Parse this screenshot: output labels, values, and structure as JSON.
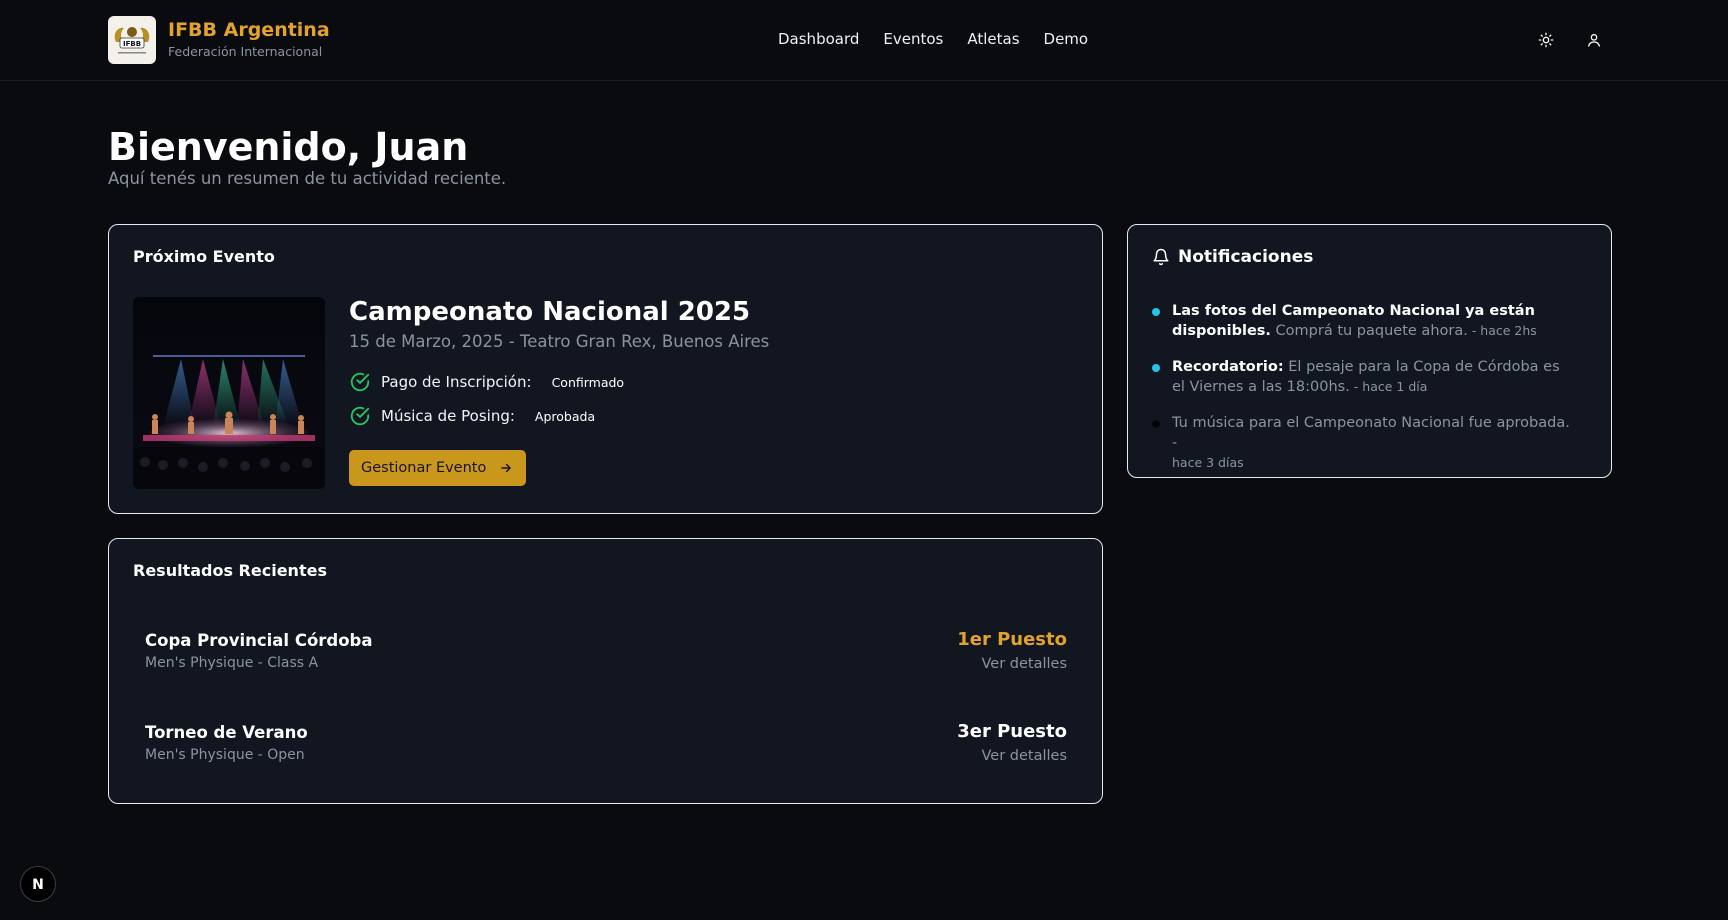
{
  "brand": {
    "title": "IFBB Argentina",
    "subtitle": "Federación Internacional",
    "logo_text": "IFBB"
  },
  "nav": {
    "items": [
      "Dashboard",
      "Eventos",
      "Atletas",
      "Demo"
    ]
  },
  "header_icons": [
    "sun-icon",
    "user-icon"
  ],
  "welcome": {
    "title": "Bienvenido, Juan",
    "subtitle": "Aquí tenés un resumen de tu actividad reciente."
  },
  "next_event": {
    "card_title": "Próximo Evento",
    "name": "Campeonato Nacional 2025",
    "meta": "15 de Marzo, 2025 - Teatro Gran Rex, Buenos Aires",
    "checks": [
      {
        "label": "Pago de Inscripción:",
        "status": "Confirmado"
      },
      {
        "label": "Música de Posing:",
        "status": "Aprobada"
      }
    ],
    "button": "Gestionar Evento"
  },
  "results": {
    "card_title": "Resultados Recientes",
    "items": [
      {
        "name": "Copa Provincial Córdoba",
        "category": "Men's Physique - Class A",
        "place": "1er Puesto",
        "link": "Ver detalles",
        "highlight": true
      },
      {
        "name": "Torneo de Verano",
        "category": "Men's Physique - Open",
        "place": "3er Puesto",
        "link": "Ver detalles",
        "highlight": false
      }
    ]
  },
  "notifications": {
    "title": "Notificaciones",
    "items": [
      {
        "bold": "Las fotos del Campeonato Nacional ya están disponibles.",
        "text": " Comprá tu paquete ahora.",
        "time": " - hace 2hs",
        "unread": true
      },
      {
        "bold": "Recordatorio:",
        "text": " El pesaje para la Copa de Córdoba es el Viernes a las 18:00hs.",
        "time": " - hace 1 día",
        "unread": true
      },
      {
        "bold": "",
        "text": "Tu música para el Campeonato Nacional fue aprobada. -",
        "time": " hace 3 días",
        "unread": false
      }
    ]
  },
  "colors": {
    "accent": "#e2a32a",
    "button": "#c9971b",
    "unread_dot": "#22c5e8",
    "check": "#22c55e"
  },
  "dev_badge": "N"
}
